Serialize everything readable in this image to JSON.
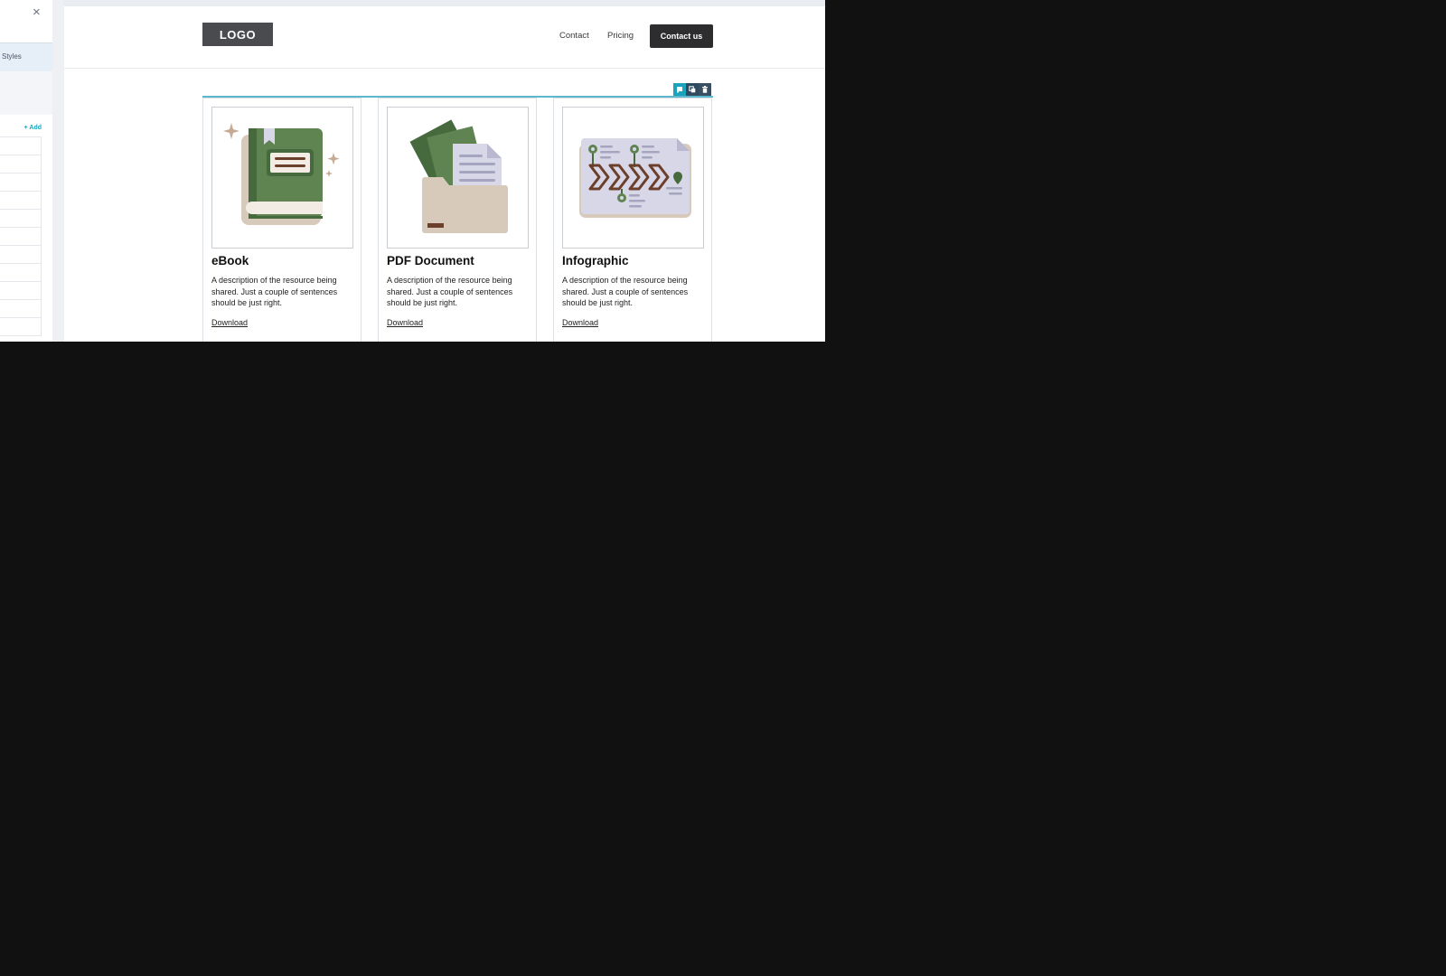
{
  "editor": {
    "close_glyph": "×",
    "styles_tab_label": "Styles",
    "add_label": "+ Add"
  },
  "site": {
    "logo_text": "LOGO",
    "nav": [
      {
        "label": "Contact"
      },
      {
        "label": "Pricing"
      }
    ],
    "cta_label": "Contact us"
  },
  "cards": [
    {
      "title": "eBook",
      "description": "A description of the resource being shared. Just a couple of sentences should be just right.",
      "link": "Download",
      "illustration": "book-icon"
    },
    {
      "title": "PDF Document",
      "description": "A description of the resource being shared. Just a couple of sentences should be just right.",
      "link": "Download",
      "illustration": "folder-document-icon"
    },
    {
      "title": "Infographic",
      "description": "A description of the resource being shared. Just a couple of sentences should be just right.",
      "link": "Download",
      "illustration": "infographic-icon"
    }
  ],
  "toolbar_icons": [
    "select-parent-icon",
    "duplicate-icon",
    "delete-icon"
  ],
  "colors": {
    "accent": "#1aa3bd",
    "button_dark": "#2d2d2f",
    "logo_bg": "#4a4b4f",
    "illustration_green": "#5f8451",
    "illustration_tan": "#d8cabb",
    "illustration_brown": "#6b3f2a"
  }
}
